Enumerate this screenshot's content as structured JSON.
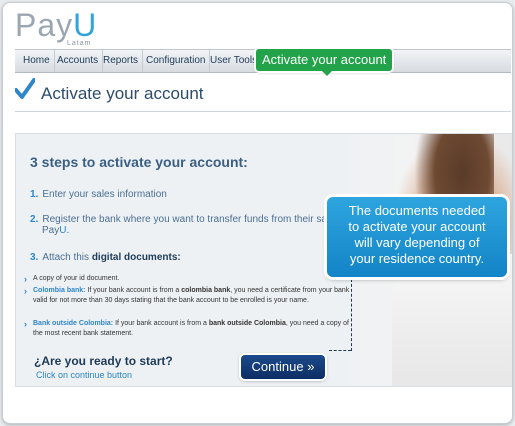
{
  "logo": {
    "brand_main": "Pay",
    "brand_accent": "U",
    "sub": "Latam"
  },
  "nav": {
    "items": [
      "Home",
      "Accounts",
      "Reports",
      "Configuration",
      "User Tools"
    ]
  },
  "tooltip": {
    "label": "Activate your account"
  },
  "page": {
    "title": "Activate your account"
  },
  "content": {
    "heading": "3 steps to activate your account:",
    "step1": "Enter your sales information",
    "step2_line1": "Register the bank where you want to transfer funds from their sales",
    "step2_line2a": "Pay",
    "step2_line2b": "U",
    "step2_line2c": ".",
    "step3_a": "Attach this ",
    "step3_b": "digital documents:",
    "bullet1": "A copy of your id document.",
    "bullet2_label": "Colombia bank:",
    "bullet2_text": " If your bank account is from a ",
    "bullet2_bold": "colombia bank",
    "bullet2_rest": ", you need a certificate from your bank valid for not more than 30 days stating that the bank account to be enrolled is your name.",
    "bullet3_label": "Bank outside Colombia:",
    "bullet3_text": " If your bank account is from a ",
    "bullet3_bold": "bank outside Colombia",
    "bullet3_rest": ", you need a copy of the most recent bank statement.",
    "ready": "¿Are you ready to start?",
    "click_text": "Click on continue button",
    "continue": "Continue »"
  },
  "bubble": {
    "line1": "The documents needed",
    "line2": "to activate your account",
    "line3": "will vary depending of",
    "line4": "your residence country."
  },
  "colors": {
    "accent": "#2e86c8",
    "green": "#22a34a",
    "navy": "#0c2e63",
    "bubble": "#1f95d6"
  },
  "icons": [
    "checkmark-icon",
    "arrow-right-icon"
  ]
}
